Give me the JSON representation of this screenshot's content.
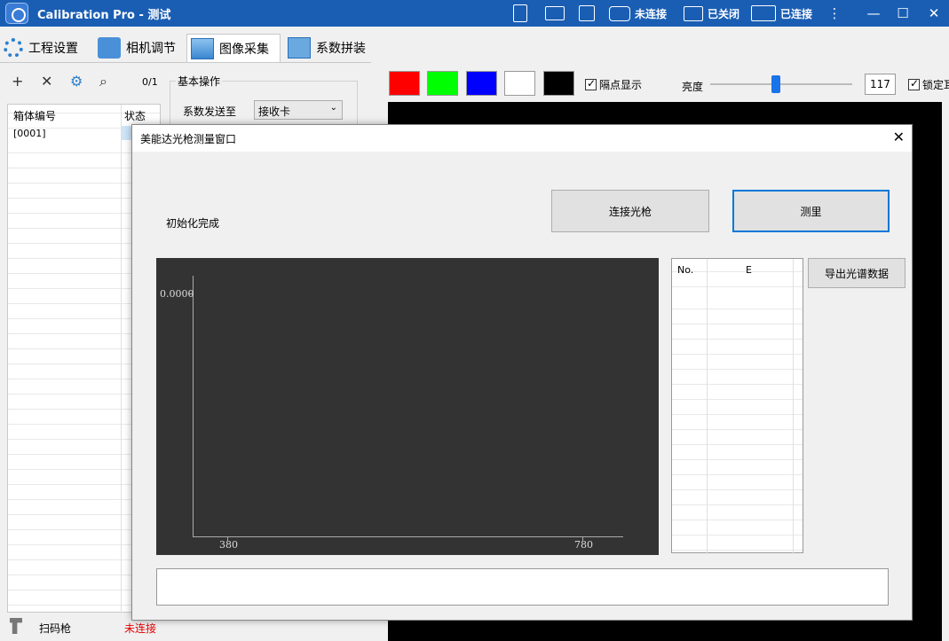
{
  "window": {
    "title": "Calibration Pro - 测试",
    "camera_status": "未连接",
    "image_status": "已关闭",
    "network_status": "已连接"
  },
  "tabs": [
    "工程设置",
    "相机调节",
    "图像采集",
    "系数拼装"
  ],
  "left_panel": {
    "counter": "0/1",
    "group_title": "基本操作",
    "send_label": "系数发送至",
    "send_target": "接收卡",
    "columns": [
      "箱体编号",
      "状态"
    ],
    "rows": [
      [
        "[0001]",
        ""
      ]
    ],
    "scanner_label": "扫码枪",
    "scanner_status": "未连接"
  },
  "toolbar": {
    "colors": [
      "#ff0000",
      "#00ff00",
      "#0000ff",
      "#ffffff",
      "#000000"
    ],
    "interlace_label": "隔点显示",
    "brightness_label": "亮度",
    "brightness_value": "117",
    "brightness_fraction": 0.46,
    "lock_label": "锁定耳"
  },
  "dialog": {
    "title": "美能达光枪测量窗口",
    "status": "初始化完成",
    "connect_button": "连接光枪",
    "measure_button": "测里",
    "export_button": "导出光谱数据",
    "table_columns": [
      "No.",
      "E"
    ],
    "chart_data": {
      "type": "line",
      "x": [],
      "series": [],
      "x_ticks": [
        "380",
        "780"
      ],
      "y_ticks": [
        "0.0000"
      ],
      "xlim": [
        380,
        780
      ],
      "title": "",
      "xlabel": "",
      "ylabel": ""
    }
  }
}
